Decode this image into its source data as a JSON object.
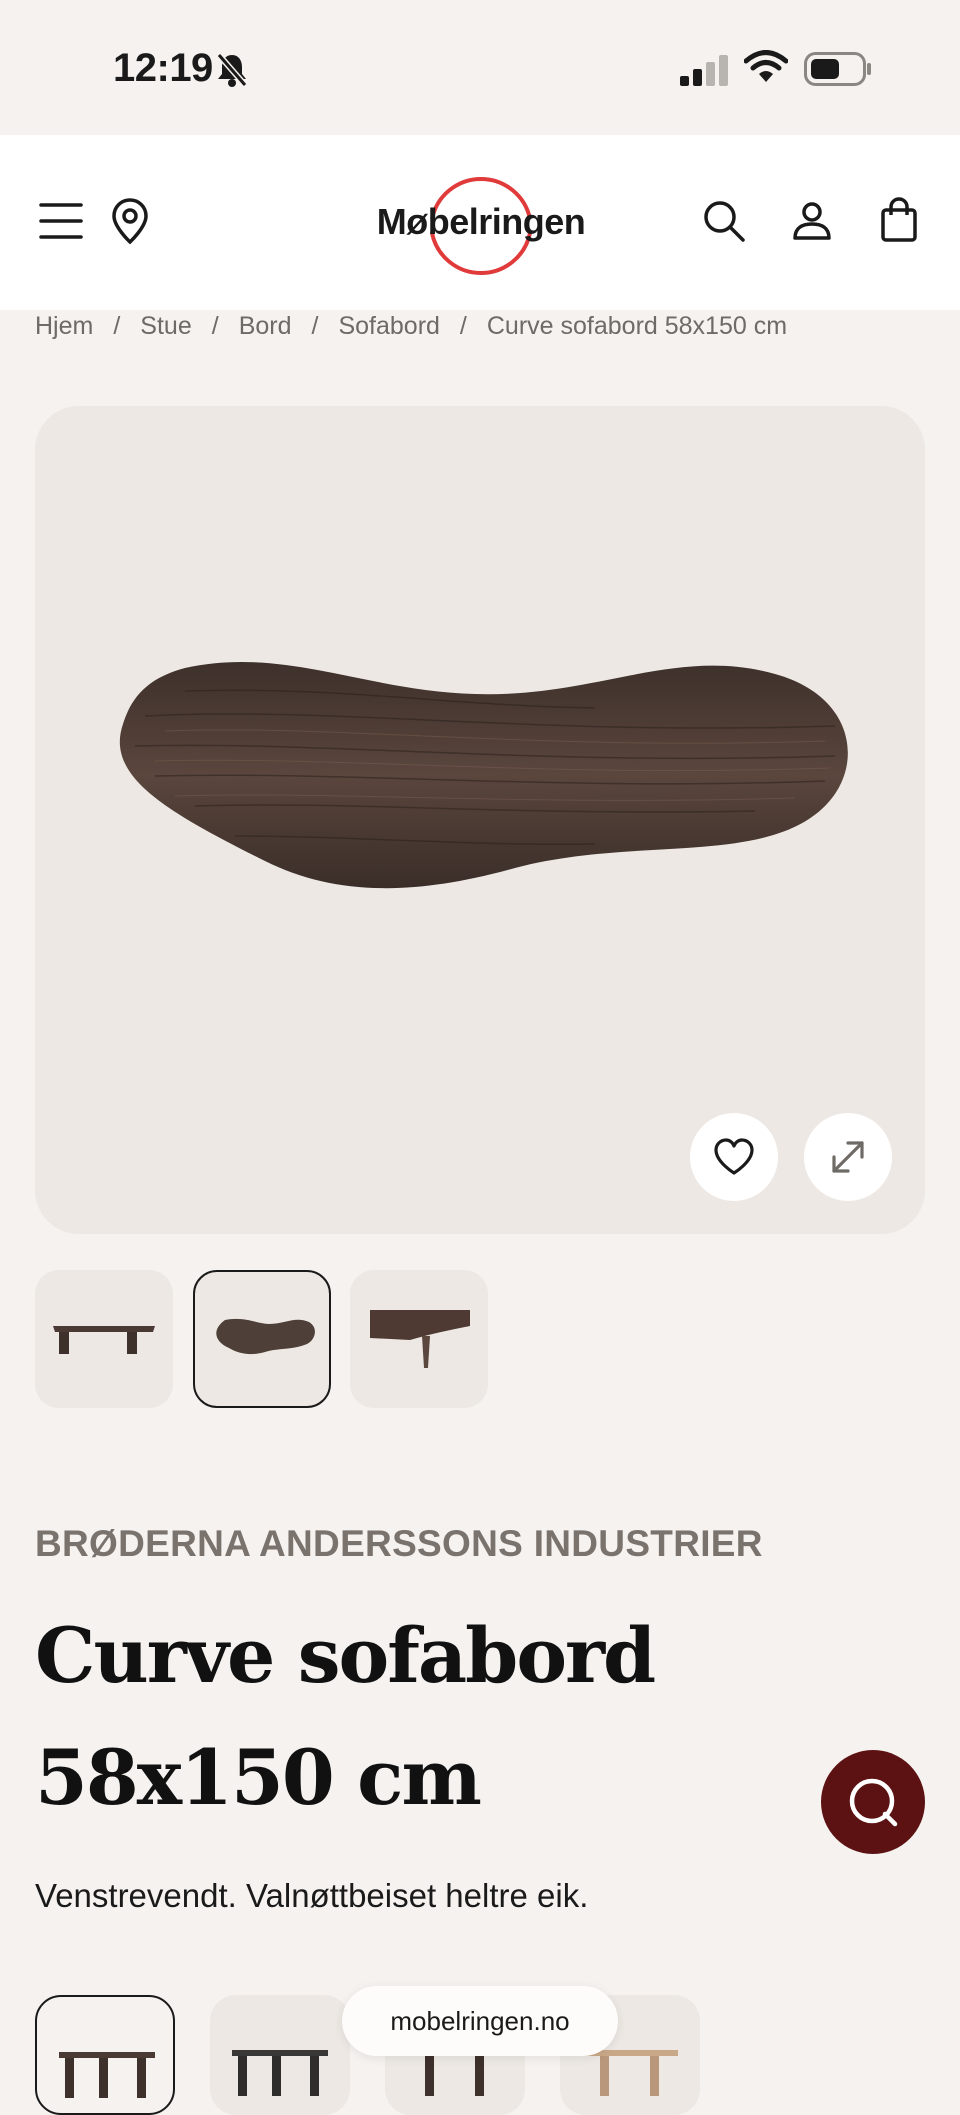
{
  "status": {
    "time": "12:19"
  },
  "header": {
    "logo_text": "Møbelringen"
  },
  "breadcrumb": [
    "Hjem",
    "Stue",
    "Bord",
    "Sofabord",
    "Curve sofabord 58x150 cm"
  ],
  "breadcrumb_separator": "/",
  "product": {
    "brand": "BRØDERNA ANDERSSONS INDUSTRIER",
    "title": "Curve sofabord 58x150 cm",
    "description": "Venstrevendt. Valnøttbeiset heltre eik."
  },
  "gallery": {
    "thumbnail_count": 3,
    "selected_index": 1
  },
  "browser": {
    "url": "mobelringen.no"
  },
  "colors": {
    "accent": "#e03a3a",
    "chat": "#5c1212",
    "background": "#f5f2ef",
    "card": "#ede8e3",
    "wood": "#4a3a33"
  }
}
